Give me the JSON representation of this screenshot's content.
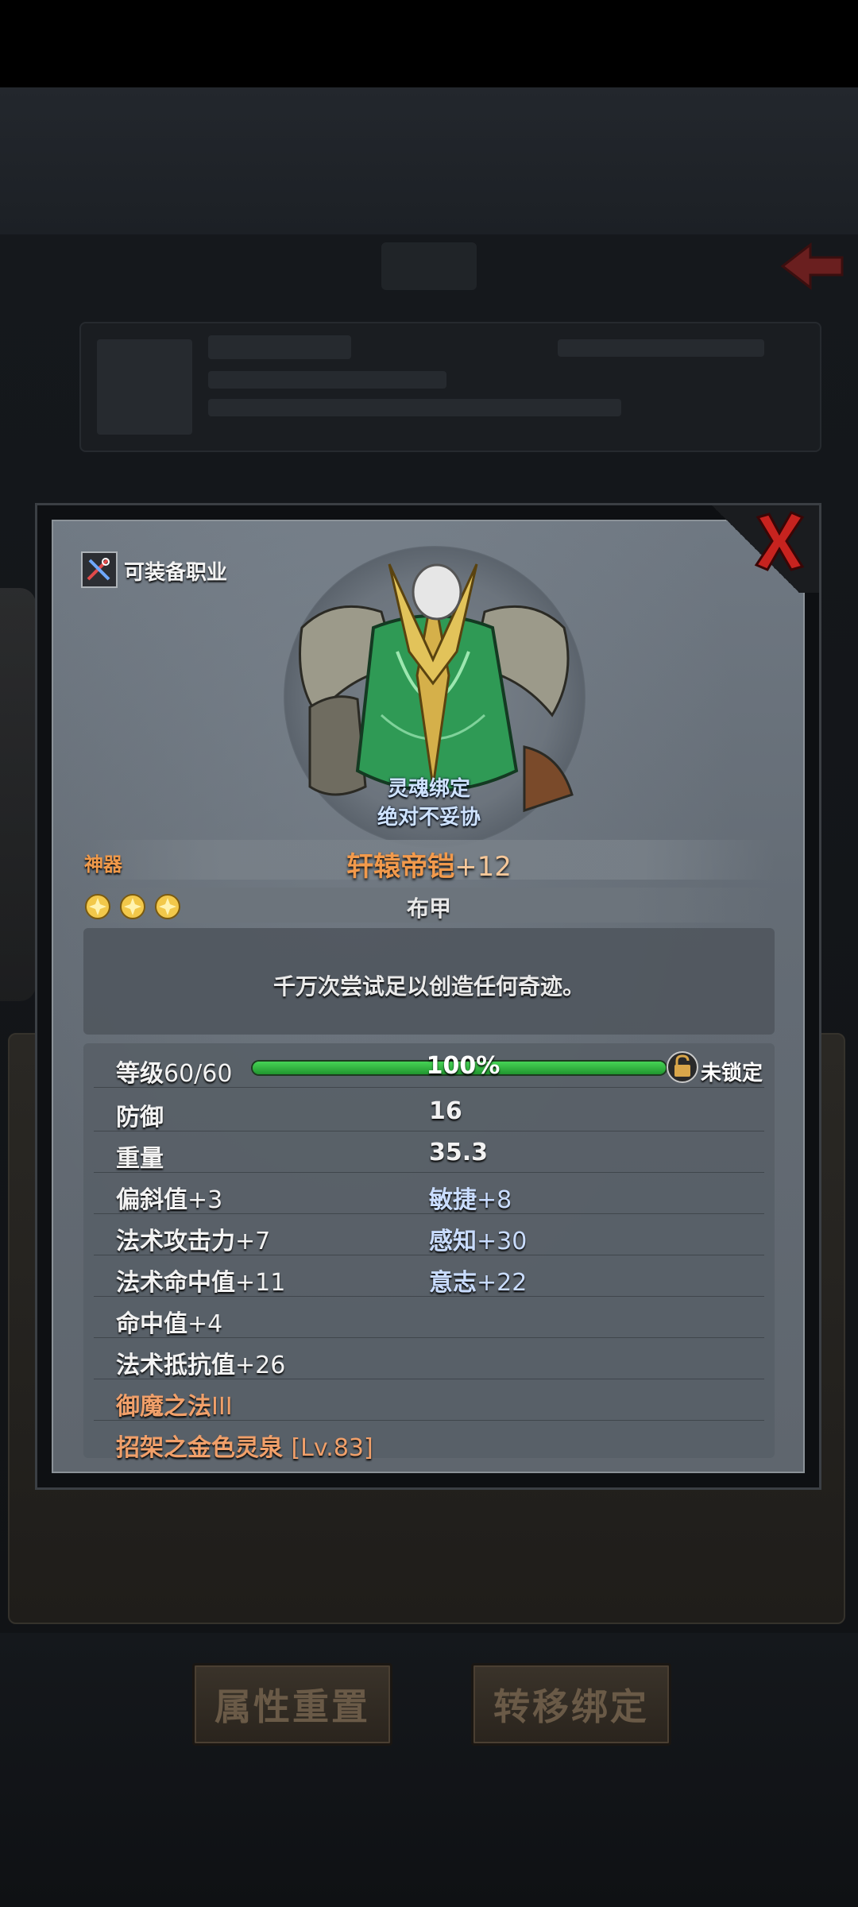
{
  "background": {
    "buttons": [
      "属性重置",
      "转移绑定"
    ]
  },
  "popup": {
    "class_label": "可装备职业",
    "soul_line1": "灵魂绑定",
    "soul_line2": "绝对不妥协",
    "rarity": "神器",
    "item_name": "轩辕帝铠",
    "item_plus": "+12",
    "item_type": "布甲",
    "star_count": 3,
    "description": "千万次尝试足以创造任何奇迹。",
    "level_label": "等级",
    "level_value": "60/60",
    "progress_text": "100%",
    "progress": 1.0,
    "lock_label": "未锁定",
    "stats": [
      {
        "left_label": "防御",
        "left_value": "",
        "right": "16"
      },
      {
        "left_label": "重量",
        "left_value": "",
        "right": "35.3"
      },
      {
        "left_label": "偏斜值",
        "left_value": "+3",
        "right_label": "敏捷",
        "right_value": "+8"
      },
      {
        "left_label": "法术攻击力",
        "left_value": "+7",
        "right_label": "感知",
        "right_value": "+30"
      },
      {
        "left_label": "法术命中值",
        "left_value": "+11",
        "right_label": "意志",
        "right_value": "+22"
      },
      {
        "left_label": "命中值",
        "left_value": "+4"
      },
      {
        "left_label": "法术抵抗值",
        "left_value": "+26"
      },
      {
        "left_label": "御魔之法",
        "left_value": "III"
      },
      {
        "left_label": "招架之金色灵泉",
        "left_value": "[Lv.83]"
      }
    ]
  },
  "colors": {
    "rarity_orange": "#f29a4c",
    "stat_blue": "#c9dcff",
    "skill_orange": "#f1a06a",
    "progress_green": "#2fb53f"
  },
  "icons": [
    "class-icon",
    "close-icon",
    "star-icon",
    "lock-icon",
    "armor-image"
  ]
}
